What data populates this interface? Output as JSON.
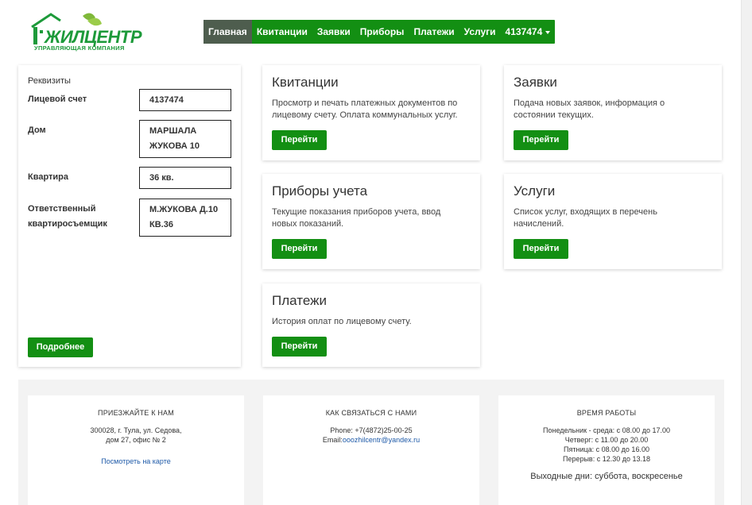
{
  "logo": {
    "brand": "ЖИЛЦЕНТР",
    "subtitle": "УПРАВЛЯЮЩАЯ КОМПАНИЯ"
  },
  "nav": {
    "items": [
      "Главная",
      "Квитанции",
      "Заявки",
      "Приборы",
      "Платежи",
      "Услуги"
    ],
    "account": "4137474"
  },
  "requisites": {
    "title": "Реквизиты",
    "account_label": "Лицевой счет",
    "account_value": "4137474",
    "house_label": "Дом",
    "house_value_line1": "МАРШАЛА",
    "house_value_line2": "ЖУКОВА 10",
    "flat_label": "Квартира",
    "flat_value": "36 кв.",
    "owner_label_line1": "Ответственный",
    "owner_label_line2": "квартиросъемщик",
    "owner_value_line1": "М.ЖУКОВА Д.10",
    "owner_value_line2": "КВ.36",
    "more_button": "Подробнее"
  },
  "cards": {
    "receipts": {
      "title": "Квитанции",
      "desc_line1": "Просмотр и печать платежных документов по",
      "desc_line2": "лицевому счету. Оплата коммунальных услуг.",
      "button": "Перейти"
    },
    "requests": {
      "title": "Заявки",
      "desc_line1": "Подача новых заявок, информация о",
      "desc_line2": "состоянии текущих.",
      "button": "Перейти"
    },
    "meters": {
      "title": "Приборы учета",
      "desc_line1": "Текущие показания приборов учета, ввод",
      "desc_line2": "новых показаний.",
      "button": "Перейти"
    },
    "services": {
      "title": "Услуги",
      "desc_line1": "Список услуг, входящих в перечень",
      "desc_line2": "начислений.",
      "button": "Перейти"
    },
    "payments": {
      "title": "Платежи",
      "desc_line1": "История оплат по лицевому счету.",
      "button": "Перейти"
    }
  },
  "footer": {
    "visit": {
      "heading": "ПРИЕЗЖАЙТЕ К НАМ",
      "line1": "300028, г. Тула, ул. Седова,",
      "line2": "дом 27, офис № 2",
      "map_link": "Посмотреть на карте"
    },
    "contact": {
      "heading": "КАК СВЯЗАТЬСЯ С НАМИ",
      "phone": "Phone: +7(4872)25-00-25",
      "email_label": "Email:",
      "email": "ooozhilcentr@yandex.ru"
    },
    "hours": {
      "heading": "ВРЕМЯ РАБОТЫ",
      "line1": "Понедельник - среда: с 08.00 до 17.00",
      "line2": "Четверг: с 11.00 до 20.00",
      "line3": "Пятница: с 08.00 до 16.00",
      "line4": "Перерыв: с 12.30 до 13.18",
      "weekend": "Выходные дни: суббота, воскресенье"
    }
  },
  "colors": {
    "brand_green": "#138f13",
    "active_nav": "#4e5d4e",
    "link_blue": "#1e5aa8"
  },
  "icons": {
    "logo": "house-leaf-logo-icon",
    "account_menu": "caret-down-icon"
  }
}
